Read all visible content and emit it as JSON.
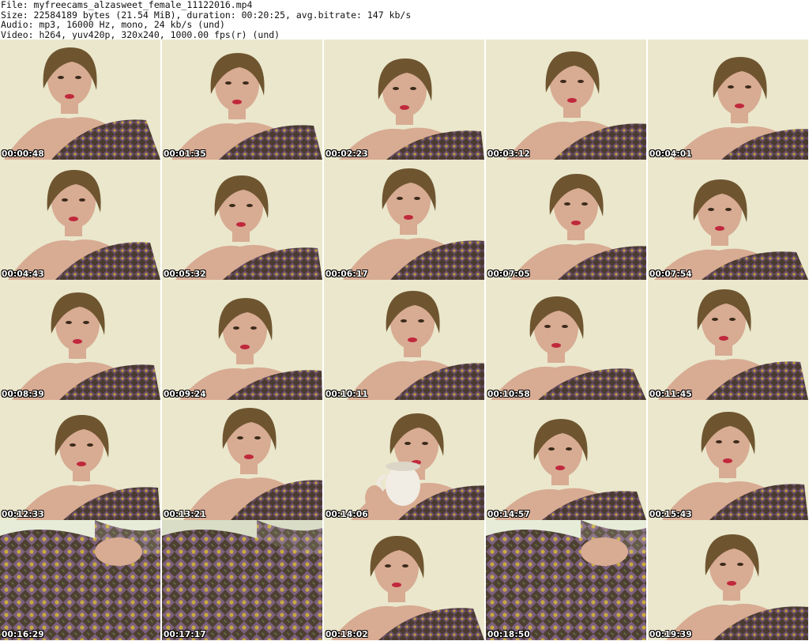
{
  "header": {
    "file_line": "File: myfreecams_alzasweet_female_11122016.mp4",
    "size_line": "Size: 22584189 bytes (21.54 MiB), duration: 00:20:25, avg.bitrate: 147 kb/s",
    "audio_line": "Audio: mp3, 16000 Hz, mono, 24 kb/s (und)",
    "video_line": "Video: h264, yuv420p, 320x240, 1000.00 fps(r) (und)"
  },
  "colors": {
    "wall": "#e7e4c6",
    "hair": "#6e5530",
    "skin": "#d8ab93",
    "shirt": "#4a3a30",
    "lips": "#c0283c",
    "timestamp": "#ffffff"
  },
  "thumbnails": [
    {
      "timestamp": "00:00:48",
      "scene": "portrait"
    },
    {
      "timestamp": "00:01:35",
      "scene": "portrait"
    },
    {
      "timestamp": "00:02:23",
      "scene": "portrait"
    },
    {
      "timestamp": "00:03:12",
      "scene": "portrait"
    },
    {
      "timestamp": "00:04:01",
      "scene": "portrait"
    },
    {
      "timestamp": "00:04:43",
      "scene": "portrait"
    },
    {
      "timestamp": "00:05:32",
      "scene": "portrait"
    },
    {
      "timestamp": "00:06:17",
      "scene": "portrait"
    },
    {
      "timestamp": "00:07:05",
      "scene": "portrait"
    },
    {
      "timestamp": "00:07:54",
      "scene": "portrait"
    },
    {
      "timestamp": "00:08:39",
      "scene": "portrait"
    },
    {
      "timestamp": "00:09:24",
      "scene": "portrait"
    },
    {
      "timestamp": "00:10:11",
      "scene": "portrait"
    },
    {
      "timestamp": "00:10:58",
      "scene": "portrait"
    },
    {
      "timestamp": "00:11:45",
      "scene": "portrait"
    },
    {
      "timestamp": "00:12:33",
      "scene": "portrait"
    },
    {
      "timestamp": "00:13:21",
      "scene": "portrait"
    },
    {
      "timestamp": "00:14:06",
      "scene": "cup"
    },
    {
      "timestamp": "00:14:57",
      "scene": "portrait"
    },
    {
      "timestamp": "00:15:43",
      "scene": "portrait"
    },
    {
      "timestamp": "00:16:29",
      "scene": "fabric"
    },
    {
      "timestamp": "00:17:17",
      "scene": "fabric"
    },
    {
      "timestamp": "00:18:02",
      "scene": "portrait"
    },
    {
      "timestamp": "00:18:50",
      "scene": "fabric"
    },
    {
      "timestamp": "00:19:39",
      "scene": "portrait"
    }
  ]
}
